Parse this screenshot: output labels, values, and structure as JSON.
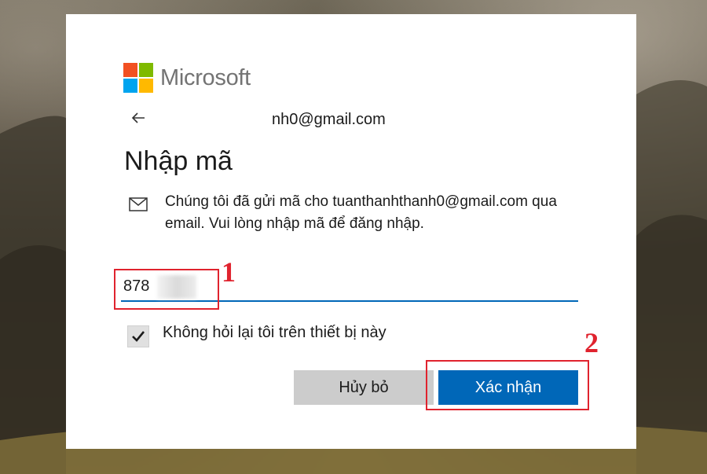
{
  "brand": {
    "name": "Microsoft",
    "logo_colors": [
      "#f25022",
      "#7fba00",
      "#00a4ef",
      "#ffb900"
    ]
  },
  "identity": {
    "email": "nh0@gmail.com"
  },
  "page": {
    "title": "Nhập mã",
    "description": "Chúng tôi đã gửi mã cho tuanthanhthanh0@gmail.com qua email. Vui lòng nhập mã để đăng nhập."
  },
  "code_field": {
    "value": "878"
  },
  "remember": {
    "label": "Không hỏi lại tôi trên thiết bị này",
    "checked": true
  },
  "buttons": {
    "cancel": "Hủy bỏ",
    "confirm": "Xác nhận"
  },
  "annotations": {
    "step1": "1",
    "step2": "2",
    "color": "#e0232e"
  },
  "colors": {
    "accent": "#0067b8",
    "cancel_bg": "#cccccc"
  }
}
